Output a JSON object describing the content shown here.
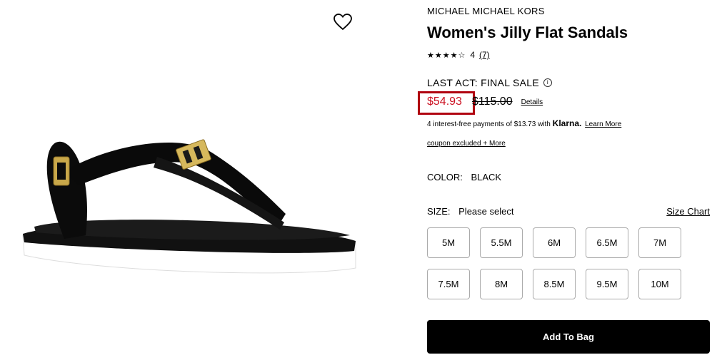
{
  "product": {
    "brand": "MICHAEL MICHAEL KORS",
    "title": "Women's Jilly Flat Sandals",
    "stars": "★★★★☆",
    "rating": "4",
    "review_count": "(7)",
    "sale_label": "LAST ACT: FINAL SALE",
    "info_glyph": "i",
    "price": "$54.93",
    "original_price": "$115.00",
    "details_link": "Details",
    "klarna_text": "4 interest-free payments of $13.73 with",
    "klarna_brand": "Klarna.",
    "klarna_learn": "Learn More",
    "coupon_text": "coupon excluded + More",
    "color_label": "COLOR:",
    "color_value": "BLACK",
    "size_label": "SIZE:",
    "size_placeholder": "Please select",
    "size_chart": "Size Chart",
    "sizes": [
      "5M",
      "5.5M",
      "6M",
      "6.5M",
      "7M",
      "7.5M",
      "8M",
      "8.5M",
      "9.5M",
      "10M"
    ],
    "add_to_bag": "Add To Bag"
  },
  "colors": {
    "sale_price": "#cc1122",
    "highlight_box": "#b0000f"
  },
  "icons": {
    "favorite": "heart-icon",
    "info": "info-icon"
  }
}
